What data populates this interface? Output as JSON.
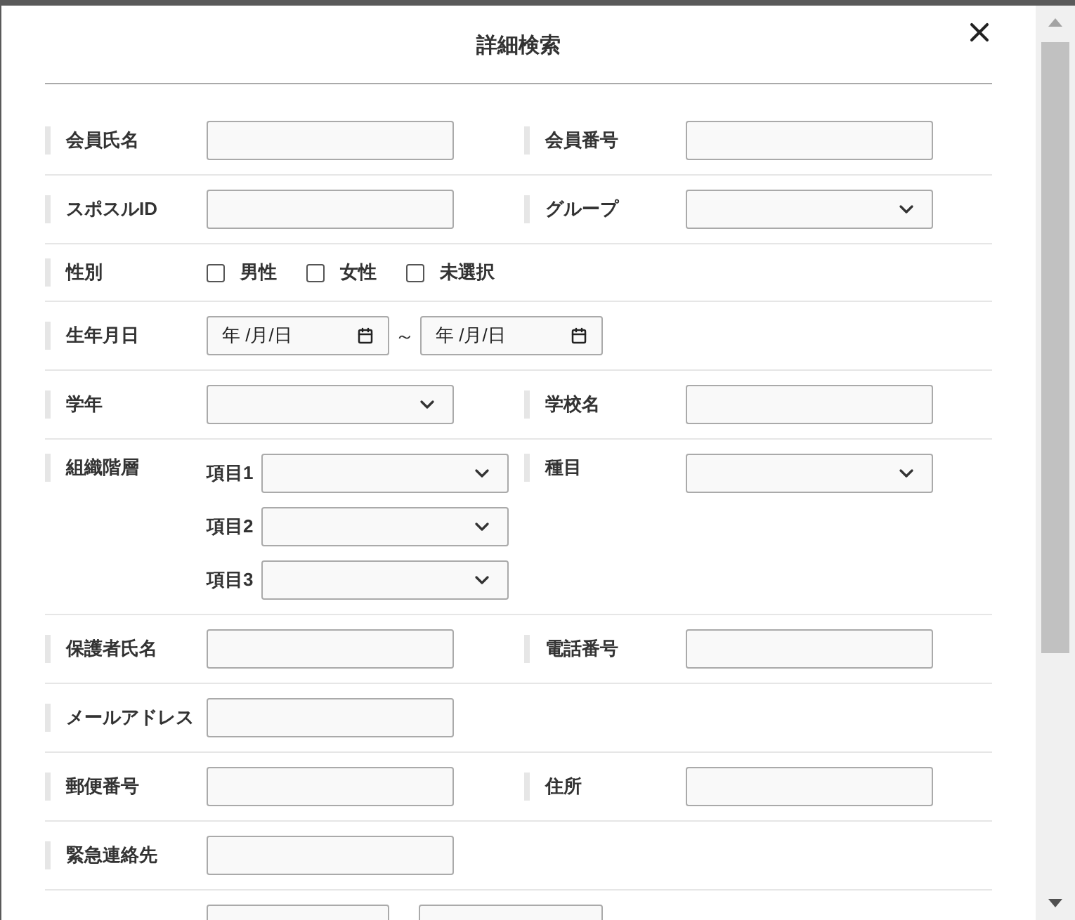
{
  "dialog": {
    "title": "詳細検索"
  },
  "rows": [
    {
      "kind": "pair",
      "items": [
        {
          "label": "会員氏名",
          "kind": "text"
        },
        {
          "label": "会員番号",
          "kind": "text"
        }
      ]
    },
    {
      "kind": "pair",
      "items": [
        {
          "label": "スポスルID",
          "kind": "text"
        },
        {
          "label": "グループ",
          "kind": "select"
        }
      ]
    },
    {
      "kind": "checks",
      "label": "性別",
      "options": [
        {
          "label": "男性",
          "checked": false
        },
        {
          "label": "女性",
          "checked": false
        },
        {
          "label": "未選択",
          "checked": false
        }
      ]
    },
    {
      "kind": "date_range",
      "label": "生年月日",
      "from": "年 /月/日",
      "separator": "～",
      "to": "年 /月/日"
    },
    {
      "kind": "pair",
      "items": [
        {
          "label": "学年",
          "kind": "select"
        },
        {
          "label": "学校名",
          "kind": "text"
        }
      ]
    },
    {
      "kind": "pair",
      "items": [
        {
          "label": "組織階層",
          "kind": "sub_selects",
          "subs": [
            "項目1",
            "項目2",
            "項目3"
          ]
        },
        {
          "label": "種目",
          "kind": "select"
        }
      ]
    },
    {
      "kind": "pair",
      "items": [
        {
          "label": "保護者氏名",
          "kind": "text"
        },
        {
          "label": "電話番号",
          "kind": "text"
        }
      ]
    },
    {
      "kind": "pair",
      "items": [
        {
          "label": "メールアドレス",
          "kind": "text"
        }
      ]
    },
    {
      "kind": "pair",
      "items": [
        {
          "label": "郵便番号",
          "kind": "text"
        },
        {
          "label": "住所",
          "kind": "text"
        }
      ]
    },
    {
      "kind": "pair",
      "items": [
        {
          "label": "緊急連絡先",
          "kind": "text"
        }
      ]
    },
    {
      "kind": "cut_range"
    }
  ]
}
